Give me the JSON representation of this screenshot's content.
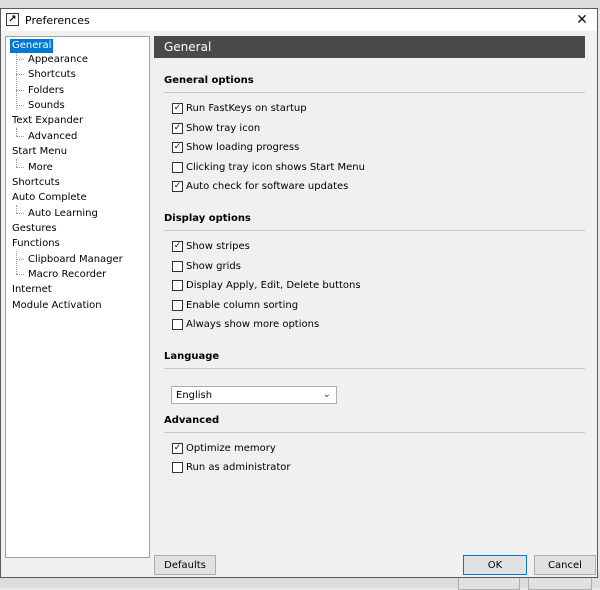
{
  "window": {
    "title": "Preferences"
  },
  "tree": {
    "items": [
      {
        "label": "General"
      },
      {
        "label": "Appearance"
      },
      {
        "label": "Shortcuts"
      },
      {
        "label": "Folders"
      },
      {
        "label": "Sounds"
      },
      {
        "label": "Text Expander"
      },
      {
        "label": "Advanced"
      },
      {
        "label": "Start Menu"
      },
      {
        "label": "More"
      },
      {
        "label": "Shortcuts"
      },
      {
        "label": "Auto Complete"
      },
      {
        "label": "Auto Learning"
      },
      {
        "label": "Gestures"
      },
      {
        "label": "Functions"
      },
      {
        "label": "Clipboard Manager"
      },
      {
        "label": "Macro Recorder"
      },
      {
        "label": "Internet"
      },
      {
        "label": "Module Activation"
      }
    ]
  },
  "content": {
    "header": "General",
    "general_options": {
      "title": "General options",
      "items": [
        {
          "label": "Run FastKeys on startup",
          "checked": true
        },
        {
          "label": "Show tray icon",
          "checked": true
        },
        {
          "label": "Show loading progress",
          "checked": true
        },
        {
          "label": "Clicking tray icon shows Start Menu",
          "checked": false
        },
        {
          "label": "Auto check for software updates",
          "checked": true
        }
      ]
    },
    "display_options": {
      "title": "Display options",
      "items": [
        {
          "label": "Show stripes",
          "checked": true
        },
        {
          "label": "Show grids",
          "checked": false
        },
        {
          "label": "Display Apply, Edit, Delete buttons",
          "checked": false
        },
        {
          "label": "Enable column sorting",
          "checked": false
        },
        {
          "label": "Always show more options",
          "checked": false
        }
      ]
    },
    "language": {
      "title": "Language",
      "selected": "English"
    },
    "advanced": {
      "title": "Advanced",
      "items": [
        {
          "label": "Optimize memory",
          "checked": true
        },
        {
          "label": "Run as administrator",
          "checked": false
        }
      ]
    }
  },
  "buttons": {
    "defaults": "Defaults",
    "ok": "OK",
    "cancel": "Cancel"
  },
  "colors": {
    "selection": "#0078d7",
    "header_bg": "#4a4a4a"
  }
}
